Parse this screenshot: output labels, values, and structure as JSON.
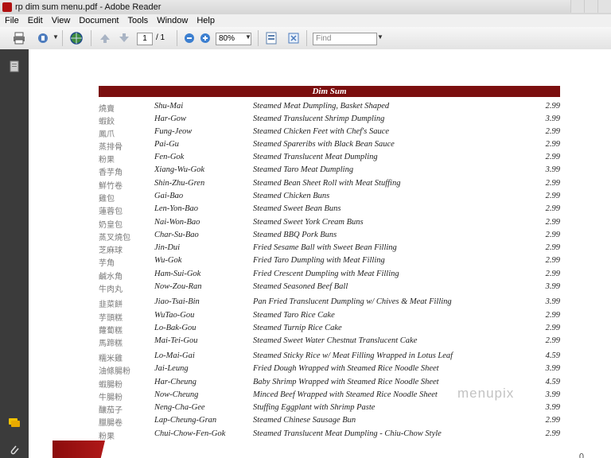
{
  "window": {
    "title": "rp dim sum menu.pdf - Adobe Reader"
  },
  "menu": [
    "File",
    "Edit",
    "View",
    "Document",
    "Tools",
    "Window",
    "Help"
  ],
  "toolbar": {
    "page_current": "1",
    "page_total": "/ 1",
    "zoom": "80%",
    "find_placeholder": "Find"
  },
  "pdf": {
    "section_title": "Dim Sum",
    "items": [
      {
        "cn": "燒賣",
        "rom": "Shu-Mai",
        "desc": "Steamed Meat Dumpling, Basket Shaped",
        "price": "2.99"
      },
      {
        "cn": "蝦餃",
        "rom": "Har-Gow",
        "desc": "Steamed Translucent Shrimp Dumpling",
        "price": "3.99"
      },
      {
        "cn": "鳳爪",
        "rom": "Fung-Jeow",
        "desc": "Steamed Chicken Feet with Chef's Sauce",
        "price": "2.99"
      },
      {
        "cn": "蒸排骨",
        "rom": "Pai-Gu",
        "desc": "Steamed Spareribs with Black Bean Sauce",
        "price": "2.99"
      },
      {
        "cn": "粉果",
        "rom": "Fen-Gok",
        "desc": "Steamed Translucent Meat Dumpling",
        "price": "2.99"
      },
      {
        "cn": "香芋角",
        "rom": "Xiang-Wu-Gok",
        "desc": "Steamed Taro Meat Dumpling",
        "price": "3.99"
      },
      {
        "cn": "鮮竹卷",
        "rom": "Shin-Zhu-Gren",
        "desc": "Steamed Bean Sheet Roll with Meat Stuffing",
        "price": "2.99"
      },
      {
        "cn": "雞包",
        "rom": "Gai-Bao",
        "desc": "Steamed Chicken Buns",
        "price": "2.99"
      },
      {
        "cn": "蓮蓉包",
        "rom": "Len-Yon-Bao",
        "desc": "Steamed Sweet Bean Buns",
        "price": "2.99"
      },
      {
        "cn": "奶皇包",
        "rom": "Nai-Won-Bao",
        "desc": "Steamed Sweet York Cream Buns",
        "price": "2.99"
      },
      {
        "cn": "蒸叉燒包",
        "rom": "Char-Su-Bao",
        "desc": "Steamed BBQ Pork Buns",
        "price": "2.99"
      },
      {
        "cn": "芝麻球",
        "rom": "Jin-Dui",
        "desc": "Fried Sesame Ball with Sweet Bean Filling",
        "price": "2.99"
      },
      {
        "cn": "芋角",
        "rom": "Wu-Gok",
        "desc": "Fried Taro Dumpling with Meat Filling",
        "price": "2.99"
      },
      {
        "cn": "鹹水角",
        "rom": "Ham-Sui-Gok",
        "desc": "Fried Crescent Dumpling with Meat Filling",
        "price": "2.99"
      },
      {
        "cn": "牛肉丸",
        "rom": "Now-Zou-Ran",
        "desc": "Steamed Seasoned Beef Ball",
        "price": "3.99"
      },
      {
        "cn": "韭菜餅",
        "rom": "Jiao-Tsai-Bin",
        "desc": "Pan Fried Translucent Dumpling w/ Chives & Meat Filling",
        "price": "3.99"
      },
      {
        "cn": "芋頭糕",
        "rom": "WuTao-Gou",
        "desc": "Steamed Taro Rice Cake",
        "price": "2.99"
      },
      {
        "cn": "蘿蔔糕",
        "rom": "Lo-Bak-Gou",
        "desc": "Steamed Turnip Rice Cake",
        "price": "2.99"
      },
      {
        "cn": "馬蹄糕",
        "rom": "Mai-Tei-Gou",
        "desc": "Steamed Sweet Water Chestnut Translucent Cake",
        "price": "2.99"
      },
      {
        "cn": "糯米雞",
        "rom": "Lo-Mai-Gai",
        "desc": "Steamed Sticky Rice w/ Meat Filling Wrapped in Lotus Leaf",
        "price": "4.59"
      },
      {
        "cn": "油條腸粉",
        "rom": "Jai-Leung",
        "desc": "Fried Dough Wrapped with Steamed Rice Noodle Sheet",
        "price": "3.99"
      },
      {
        "cn": "蝦腸粉",
        "rom": "Har-Cheung",
        "desc": "Baby Shrimp Wrapped with Steamed Rice Noodle Sheet",
        "price": "4.59"
      },
      {
        "cn": "牛腸粉",
        "rom": "Now-Cheung",
        "desc": "Minced Beef Wrapped with Steamed Rice Noodle Sheet",
        "price": "3.99"
      },
      {
        "cn": "釀茄子",
        "rom": "Neng-Cha-Gee",
        "desc": "Stuffing Eggplant with Shrimp Paste",
        "price": "3.99"
      },
      {
        "cn": "臘腸卷",
        "rom": "Lap-Cheung-Gran",
        "desc": "Steamed Chinese Sausage Bun",
        "price": "2.99"
      },
      {
        "cn": "粉果",
        "rom": "Chui-Chow-Fen-Gok",
        "desc": "Steamed Translucent Meat Dumpling - Chiu-Chow Style",
        "price": "2.99"
      }
    ],
    "watermark": "menupix"
  }
}
